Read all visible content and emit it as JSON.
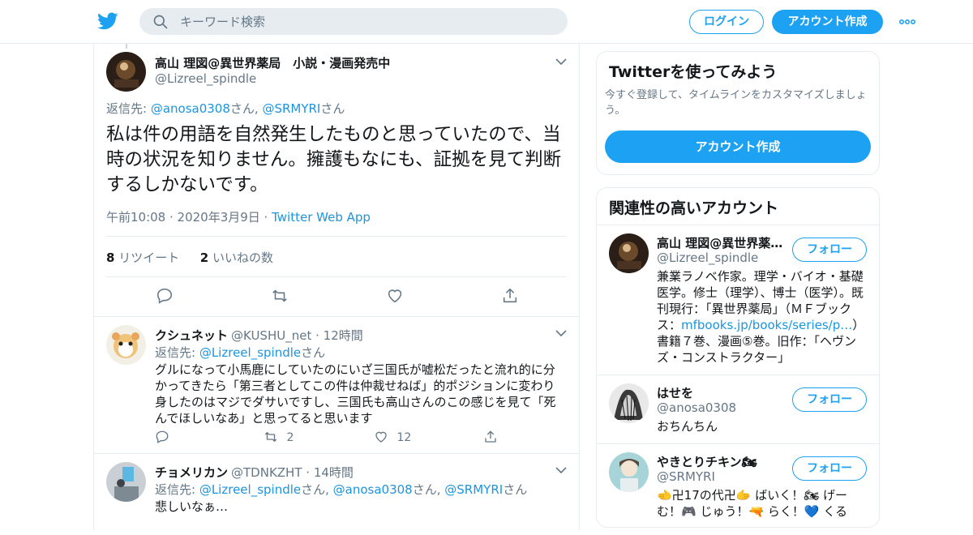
{
  "topbar": {
    "search_placeholder": "キーワード検索",
    "login_label": "ログイン",
    "signup_label": "アカウント作成"
  },
  "focus_tweet": {
    "name": "高山 理図@異世界薬局　小説・漫画発売中",
    "handle": "@Lizreel_spindle",
    "reply_prefix": "返信先: ",
    "reply_user1": "@anosa0308",
    "reply_san1": "さん, ",
    "reply_user2": "@SRMYRI",
    "reply_san2": "さん",
    "body": "私は件の用語を自然発生したものと思っていたので、当時の状況を知りません。擁護もなにも、証拠を見て判断するしかないです。",
    "time": "午前10:08 · 2020年3月9日 · ",
    "source": "Twitter Web App",
    "retweet_count": "8",
    "retweet_label": " リツイート",
    "like_count": "2",
    "like_label": " いいねの数"
  },
  "replies": [
    {
      "name": "クシュネット",
      "handle": "@KUSHU_net",
      "time": "· 12時間",
      "reply_prefix": "返信先: ",
      "reply_users": "@Lizreel_spindle",
      "reply_suffix": "さん",
      "text": "グルになって小馬鹿にしていたのにいざ三国氏が嘘松だったと流れ的に分かってきたら「第三者としてこの件は仲裁せねば」的ポジションに変わり身したのはマジでダサいですし、三国氏も高山さんのこの感じを見て「死んでほしいなあ」と思ってると思います",
      "retweets": "2",
      "likes": "12"
    },
    {
      "name": "チョメリカン",
      "handle": "@TDNKZHT",
      "time": "· 14時間",
      "reply_prefix": "返信先: ",
      "reply_user1": "@Lizreel_spindle",
      "reply_san1": "さん, ",
      "reply_user2": "@anosa0308",
      "reply_san2": "さん, ",
      "reply_user3": "@SRMYRI",
      "reply_san3": "さん",
      "text": "悲しいなぁ…"
    }
  ],
  "sidebar": {
    "try_title": "Twitterを使ってみよう",
    "try_desc": "今すぐ登録して、タイムラインをカスタマイズしましょう。",
    "try_button": "アカウント作成",
    "related_title": "関連性の高いアカウント",
    "follow_label": "フォロー",
    "accounts": [
      {
        "name": "高山 理図@異世界薬局　小説・漫画発売中",
        "handle": "@Lizreel_spindle",
        "bio_pre": "兼業ラノベ作家。理学・バイオ・基礎医学。修士（理学）、博士（医学）。既刊現行：「異世界薬局」（ＭＦブックス：",
        "bio_link": "mfbooks.jp/books/series/p…",
        "bio_post": "）書籍７巻、漫画⑤巻。旧作：「ヘヴンズ・コンストラクター」"
      },
      {
        "name": "はせを",
        "handle": "@anosa0308",
        "bio": "おちんちん"
      },
      {
        "name": "やきとりチキン🏍",
        "handle": "@SRMYRI",
        "bio": "🫲卍17の代卍🫱 ばいく！🏍 げーむ！🎮 じゅう！🔫 らく！💙 くる"
      }
    ]
  },
  "colors": {
    "accent": "#1da1f2",
    "link": "#1b95e0",
    "muted": "#657786",
    "border": "#e6ecf0"
  }
}
